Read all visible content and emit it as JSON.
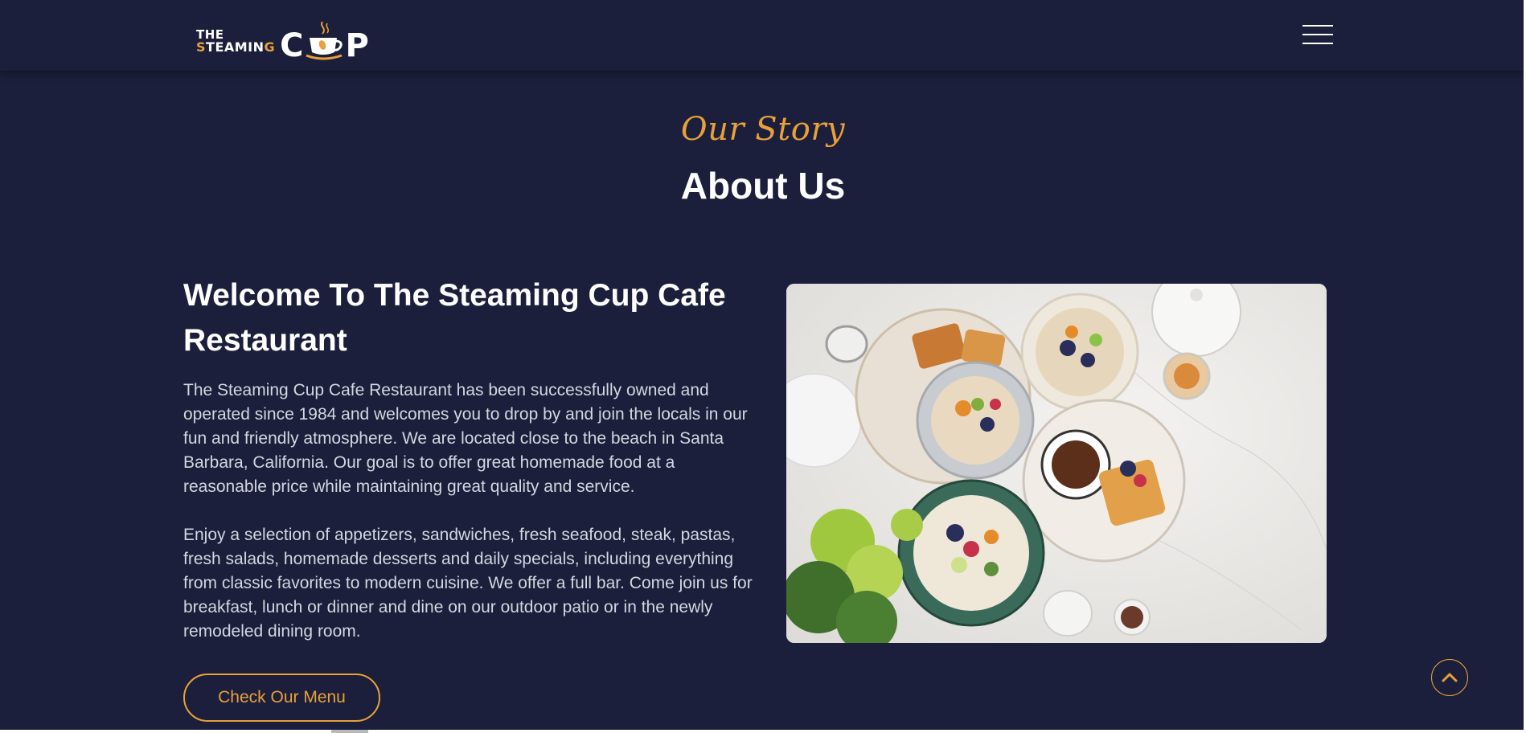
{
  "header": {
    "logo": {
      "line1": "THE",
      "line2_first": "S",
      "line2_rest": "TEAMIN",
      "line2_last": "G",
      "big_left": "C",
      "big_right": "P"
    },
    "menu_icon": "hamburger-menu-icon"
  },
  "about": {
    "script_heading": "Our Story",
    "title": "About Us",
    "welcome_heading": "Welcome To The Steaming Cup Cafe Restaurant",
    "paragraph1": "The Steaming Cup Cafe Restaurant has been successfully owned and operated since 1984 and welcomes you to drop by and join the locals in our fun and friendly atmosphere. We are located close to the beach in Santa Barbara, California. Our goal is to offer great homemade food at a reasonable price while maintaining great quality and service.",
    "paragraph2": "Enjoy a selection of appetizers, sandwiches, fresh seafood, steak, pastas, fresh salads, homemade desserts and daily specials, including everything from classic favorites to modern cuisine. We offer a full bar. Come join us for breakfast, lunch or dinner and dine on our outdoor patio or in the newly remodeled dining room.",
    "menu_button": "Check Our Menu"
  },
  "scroll_top_icon": "chevron-up-icon",
  "colors": {
    "background": "#1b1f3b",
    "accent": "#e8a03a",
    "text": "#ffffff",
    "body_text": "#d4d6e0"
  }
}
